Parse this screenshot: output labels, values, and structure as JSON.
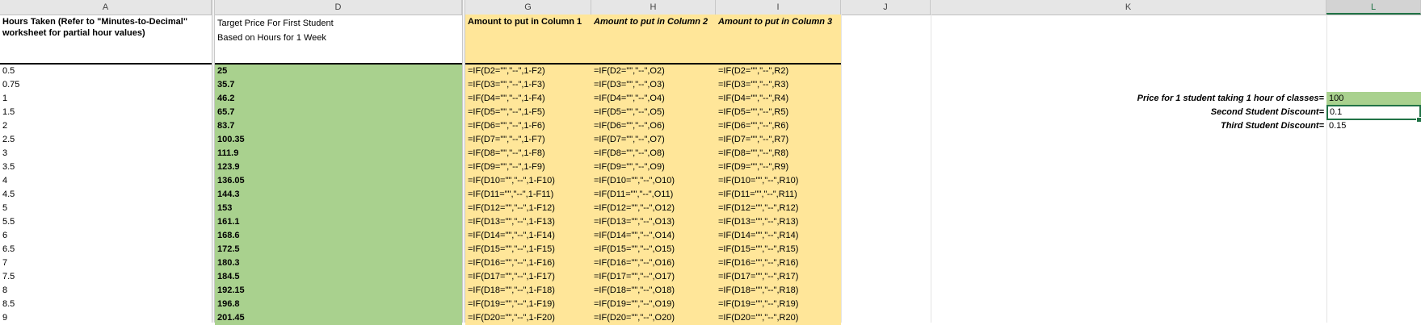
{
  "columns": [
    "A",
    "D",
    "G",
    "H",
    "I",
    "J",
    "K",
    "L"
  ],
  "selected_column": "L",
  "headers": {
    "a": "Hours Taken (Refer to \"Minutes-to-Decimal\" worksheet for partial hour values)",
    "d_line1": "Target Price For First Student",
    "d_line2": "Based on Hours for 1 Week",
    "g": "Amount to put in Column 1",
    "h": "Amount to put in Column 2",
    "i": "Amount to put in Column 3"
  },
  "rows": [
    {
      "hours": "0.5",
      "price": "25",
      "g": "=IF(D2=\"\",\"--\",1-F2)",
      "h": "=IF(D2=\"\",\"--\",O2)",
      "i": "=IF(D2=\"\",\"--\",R2)"
    },
    {
      "hours": "0.75",
      "price": "35.7",
      "g": "=IF(D3=\"\",\"--\",1-F3)",
      "h": "=IF(D3=\"\",\"--\",O3)",
      "i": "=IF(D3=\"\",\"--\",R3)"
    },
    {
      "hours": "1",
      "price": "46.2",
      "g": "=IF(D4=\"\",\"--\",1-F4)",
      "h": "=IF(D4=\"\",\"--\",O4)",
      "i": "=IF(D4=\"\",\"--\",R4)"
    },
    {
      "hours": "1.5",
      "price": "65.7",
      "g": "=IF(D5=\"\",\"--\",1-F5)",
      "h": "=IF(D5=\"\",\"--\",O5)",
      "i": "=IF(D5=\"\",\"--\",R5)"
    },
    {
      "hours": "2",
      "price": "83.7",
      "g": "=IF(D6=\"\",\"--\",1-F6)",
      "h": "=IF(D6=\"\",\"--\",O6)",
      "i": "=IF(D6=\"\",\"--\",R6)"
    },
    {
      "hours": "2.5",
      "price": "100.35",
      "g": "=IF(D7=\"\",\"--\",1-F7)",
      "h": "=IF(D7=\"\",\"--\",O7)",
      "i": "=IF(D7=\"\",\"--\",R7)"
    },
    {
      "hours": "3",
      "price": "111.9",
      "g": "=IF(D8=\"\",\"--\",1-F8)",
      "h": "=IF(D8=\"\",\"--\",O8)",
      "i": "=IF(D8=\"\",\"--\",R8)"
    },
    {
      "hours": "3.5",
      "price": "123.9",
      "g": "=IF(D9=\"\",\"--\",1-F9)",
      "h": "=IF(D9=\"\",\"--\",O9)",
      "i": "=IF(D9=\"\",\"--\",R9)"
    },
    {
      "hours": "4",
      "price": "136.05",
      "g": "=IF(D10=\"\",\"--\",1-F10)",
      "h": "=IF(D10=\"\",\"--\",O10)",
      "i": "=IF(D10=\"\",\"--\",R10)"
    },
    {
      "hours": "4.5",
      "price": "144.3",
      "g": "=IF(D11=\"\",\"--\",1-F11)",
      "h": "=IF(D11=\"\",\"--\",O11)",
      "i": "=IF(D11=\"\",\"--\",R11)"
    },
    {
      "hours": "5",
      "price": "153",
      "g": "=IF(D12=\"\",\"--\",1-F12)",
      "h": "=IF(D12=\"\",\"--\",O12)",
      "i": "=IF(D12=\"\",\"--\",R12)"
    },
    {
      "hours": "5.5",
      "price": "161.1",
      "g": "=IF(D13=\"\",\"--\",1-F13)",
      "h": "=IF(D13=\"\",\"--\",O13)",
      "i": "=IF(D13=\"\",\"--\",R13)"
    },
    {
      "hours": "6",
      "price": "168.6",
      "g": "=IF(D14=\"\",\"--\",1-F14)",
      "h": "=IF(D14=\"\",\"--\",O14)",
      "i": "=IF(D14=\"\",\"--\",R14)"
    },
    {
      "hours": "6.5",
      "price": "172.5",
      "g": "=IF(D15=\"\",\"--\",1-F15)",
      "h": "=IF(D15=\"\",\"--\",O15)",
      "i": "=IF(D15=\"\",\"--\",R15)"
    },
    {
      "hours": "7",
      "price": "180.3",
      "g": "=IF(D16=\"\",\"--\",1-F16)",
      "h": "=IF(D16=\"\",\"--\",O16)",
      "i": "=IF(D16=\"\",\"--\",R16)"
    },
    {
      "hours": "7.5",
      "price": "184.5",
      "g": "=IF(D17=\"\",\"--\",1-F17)",
      "h": "=IF(D17=\"\",\"--\",O17)",
      "i": "=IF(D17=\"\",\"--\",R17)"
    },
    {
      "hours": "8",
      "price": "192.15",
      "g": "=IF(D18=\"\",\"--\",1-F18)",
      "h": "=IF(D18=\"\",\"--\",O18)",
      "i": "=IF(D18=\"\",\"--\",R18)"
    },
    {
      "hours": "8.5",
      "price": "196.8",
      "g": "=IF(D19=\"\",\"--\",1-F19)",
      "h": "=IF(D19=\"\",\"--\",O19)",
      "i": "=IF(D19=\"\",\"--\",R19)"
    },
    {
      "hours": "9",
      "price": "201.45",
      "g": "=IF(D20=\"\",\"--\",1-F20)",
      "h": "=IF(D20=\"\",\"--\",O20)",
      "i": "=IF(D20=\"\",\"--\",R20)"
    }
  ],
  "settings": [
    {
      "label": "Price for 1 student taking 1 hour of classes=",
      "value": "100"
    },
    {
      "label": "Second Student Discount=",
      "value": "0.1"
    },
    {
      "label": "Third Student Discount=",
      "value": "0.15"
    }
  ],
  "colors": {
    "green": "#a9d18e",
    "yellow": "#ffe699",
    "excel_green": "#217346"
  }
}
